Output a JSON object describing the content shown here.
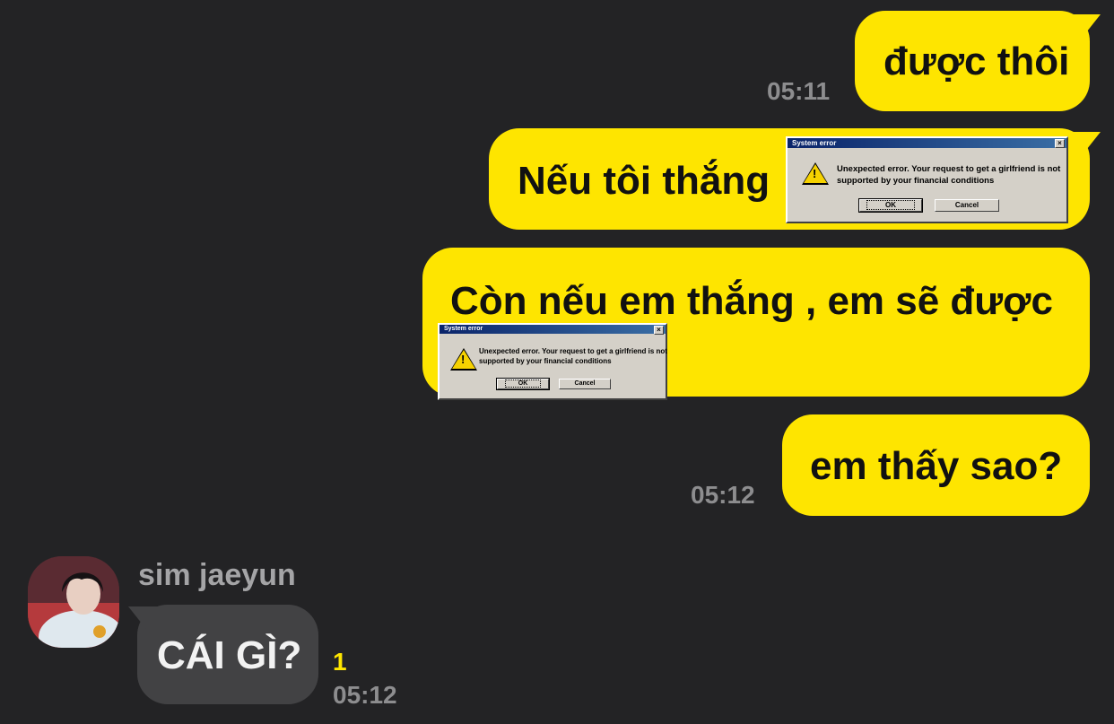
{
  "chat": {
    "messages": [
      {
        "text": "được thôi",
        "time": "05:11"
      },
      {
        "text": "Nếu tôi thắng"
      },
      {
        "text": "Còn nếu em thắng , em sẽ được"
      },
      {
        "text": "em thấy sao?",
        "time": "05:12"
      }
    ],
    "incoming": {
      "sender": "sim jaeyun",
      "text": "CÁI GÌ?",
      "unread": "1",
      "time": "05:12"
    }
  },
  "dialog": {
    "title": "System error",
    "message_line1": "Unexpected error. Your request to get a girlfriend is not",
    "message_line2": "supported by your financial conditions",
    "ok_label": "OK",
    "cancel_label": "Cancel",
    "close_label": "×",
    "icon": "warning-icon"
  },
  "colors": {
    "background": "#232325",
    "outgoing_bubble": "#fee500",
    "incoming_bubble": "#424244",
    "timestamp": "#8d8d8f"
  }
}
